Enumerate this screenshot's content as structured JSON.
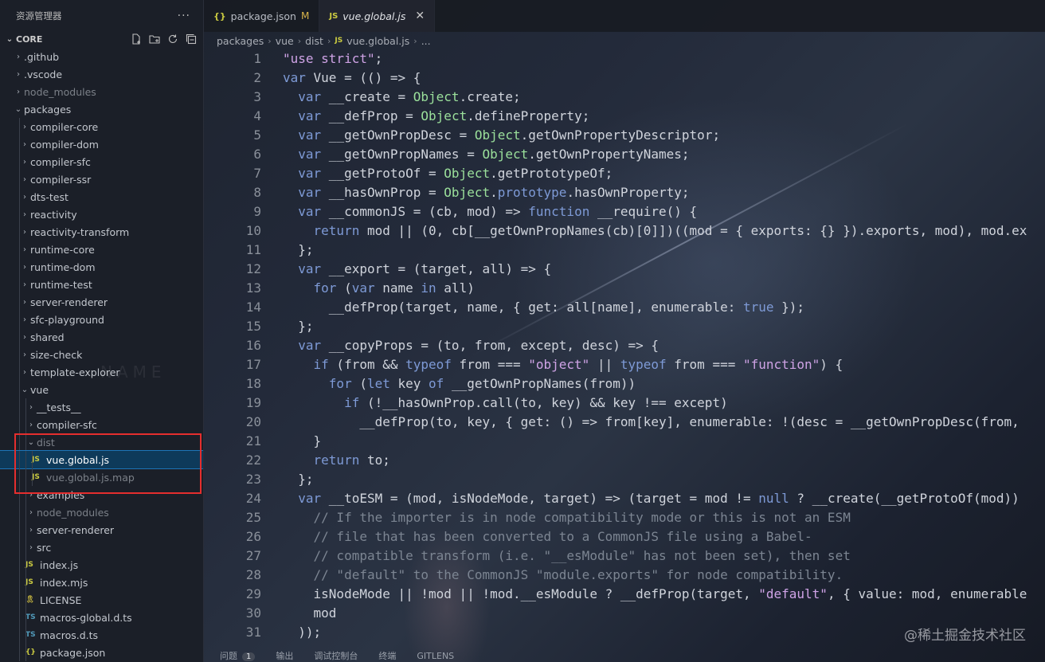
{
  "sidebar": {
    "title": "资源管理器",
    "more": "···",
    "root_label": "CORE",
    "actions": [
      "new-file-icon",
      "new-folder-icon",
      "refresh-icon",
      "collapse-all-icon"
    ],
    "background_word": "NAME",
    "items": [
      {
        "label": ".github",
        "chev": "›",
        "depth": 1,
        "type": "folder"
      },
      {
        "label": ".vscode",
        "chev": "›",
        "depth": 1,
        "type": "folder"
      },
      {
        "label": "node_modules",
        "chev": "›",
        "depth": 1,
        "type": "folder",
        "dim": true
      },
      {
        "label": "packages",
        "chev": "⌄",
        "depth": 1,
        "type": "folder-open"
      },
      {
        "label": "compiler-core",
        "chev": "›",
        "depth": 2,
        "type": "folder"
      },
      {
        "label": "compiler-dom",
        "chev": "›",
        "depth": 2,
        "type": "folder"
      },
      {
        "label": "compiler-sfc",
        "chev": "›",
        "depth": 2,
        "type": "folder"
      },
      {
        "label": "compiler-ssr",
        "chev": "›",
        "depth": 2,
        "type": "folder"
      },
      {
        "label": "dts-test",
        "chev": "›",
        "depth": 2,
        "type": "folder"
      },
      {
        "label": "reactivity",
        "chev": "›",
        "depth": 2,
        "type": "folder"
      },
      {
        "label": "reactivity-transform",
        "chev": "›",
        "depth": 2,
        "type": "folder"
      },
      {
        "label": "runtime-core",
        "chev": "›",
        "depth": 2,
        "type": "folder"
      },
      {
        "label": "runtime-dom",
        "chev": "›",
        "depth": 2,
        "type": "folder"
      },
      {
        "label": "runtime-test",
        "chev": "›",
        "depth": 2,
        "type": "folder"
      },
      {
        "label": "server-renderer",
        "chev": "›",
        "depth": 2,
        "type": "folder"
      },
      {
        "label": "sfc-playground",
        "chev": "›",
        "depth": 2,
        "type": "folder"
      },
      {
        "label": "shared",
        "chev": "›",
        "depth": 2,
        "type": "folder"
      },
      {
        "label": "size-check",
        "chev": "›",
        "depth": 2,
        "type": "folder"
      },
      {
        "label": "template-explorer",
        "chev": "›",
        "depth": 2,
        "type": "folder"
      },
      {
        "label": "vue",
        "chev": "⌄",
        "depth": 2,
        "type": "folder-open"
      },
      {
        "label": "__tests__",
        "chev": "›",
        "depth": 3,
        "type": "folder"
      },
      {
        "label": "compiler-sfc",
        "chev": "›",
        "depth": 3,
        "type": "folder"
      },
      {
        "label": "dist",
        "chev": "⌄",
        "depth": 3,
        "type": "folder-open",
        "dim": true
      },
      {
        "label": "vue.global.js",
        "icon": "JS",
        "depth": 4,
        "type": "js",
        "selected": true
      },
      {
        "label": "vue.global.js.map",
        "icon": "JS",
        "depth": 4,
        "type": "js",
        "dim": true
      },
      {
        "label": "examples",
        "chev": "›",
        "depth": 3,
        "type": "folder"
      },
      {
        "label": "node_modules",
        "chev": "›",
        "depth": 3,
        "type": "folder",
        "dim": true
      },
      {
        "label": "server-renderer",
        "chev": "›",
        "depth": 3,
        "type": "folder"
      },
      {
        "label": "src",
        "chev": "›",
        "depth": 3,
        "type": "folder"
      },
      {
        "label": "index.js",
        "icon": "JS",
        "depth": 3,
        "type": "js"
      },
      {
        "label": "index.mjs",
        "icon": "JS",
        "depth": 3,
        "type": "js"
      },
      {
        "label": "LICENSE",
        "icon": "🎗",
        "depth": 3,
        "type": "license"
      },
      {
        "label": "macros-global.d.ts",
        "icon": "TS",
        "depth": 3,
        "type": "ts"
      },
      {
        "label": "macros.d.ts",
        "icon": "TS",
        "depth": 3,
        "type": "ts"
      },
      {
        "label": "package.json",
        "icon": "{}",
        "depth": 3,
        "type": "json"
      }
    ]
  },
  "tabs": [
    {
      "label": "package.json",
      "icon": "{}",
      "badge": "M",
      "active": false
    },
    {
      "label": "vue.global.js",
      "icon": "JS",
      "close": "✕",
      "active": true
    }
  ],
  "breadcrumb": [
    "packages",
    "vue",
    "dist",
    "vue.global.js",
    "..."
  ],
  "breadcrumb_sep": "›",
  "breadcrumb_js_icon": "JS",
  "code": [
    [
      [
        "str",
        "\"use strict\""
      ],
      [
        "par",
        ";"
      ]
    ],
    [
      [
        "kw",
        "var"
      ],
      [
        "par",
        " Vue = (() => {"
      ]
    ],
    [
      [
        "par",
        "  "
      ],
      [
        "kw",
        "var"
      ],
      [
        "par",
        " __create = "
      ],
      [
        "obj",
        "Object"
      ],
      [
        "par",
        ".create;"
      ]
    ],
    [
      [
        "par",
        "  "
      ],
      [
        "kw",
        "var"
      ],
      [
        "par",
        " __defProp = "
      ],
      [
        "obj",
        "Object"
      ],
      [
        "par",
        ".defineProperty;"
      ]
    ],
    [
      [
        "par",
        "  "
      ],
      [
        "kw",
        "var"
      ],
      [
        "par",
        " __getOwnPropDesc = "
      ],
      [
        "obj",
        "Object"
      ],
      [
        "par",
        ".getOwnPropertyDescriptor;"
      ]
    ],
    [
      [
        "par",
        "  "
      ],
      [
        "kw",
        "var"
      ],
      [
        "par",
        " __getOwnPropNames = "
      ],
      [
        "obj",
        "Object"
      ],
      [
        "par",
        ".getOwnPropertyNames;"
      ]
    ],
    [
      [
        "par",
        "  "
      ],
      [
        "kw",
        "var"
      ],
      [
        "par",
        " __getProtoOf = "
      ],
      [
        "obj",
        "Object"
      ],
      [
        "par",
        ".getPrototypeOf;"
      ]
    ],
    [
      [
        "par",
        "  "
      ],
      [
        "kw",
        "var"
      ],
      [
        "par",
        " __hasOwnProp = "
      ],
      [
        "obj",
        "Object"
      ],
      [
        "par",
        "."
      ],
      [
        "kw",
        "prototype"
      ],
      [
        "par",
        ".hasOwnProperty;"
      ]
    ],
    [
      [
        "par",
        "  "
      ],
      [
        "kw",
        "var"
      ],
      [
        "par",
        " __commonJS = (cb, mod) => "
      ],
      [
        "kw",
        "function"
      ],
      [
        "par",
        " __require() {"
      ]
    ],
    [
      [
        "par",
        "    "
      ],
      [
        "kw",
        "return"
      ],
      [
        "par",
        " mod || (0, cb[__getOwnPropNames(cb)[0]])((mod = { exports: {} }).exports, mod), mod.ex"
      ]
    ],
    [
      [
        "par",
        "  };"
      ]
    ],
    [
      [
        "par",
        "  "
      ],
      [
        "kw",
        "var"
      ],
      [
        "par",
        " __export = (target, all) => {"
      ]
    ],
    [
      [
        "par",
        "    "
      ],
      [
        "kw",
        "for"
      ],
      [
        "par",
        " ("
      ],
      [
        "kw",
        "var"
      ],
      [
        "par",
        " name "
      ],
      [
        "kw",
        "in"
      ],
      [
        "par",
        " all)"
      ]
    ],
    [
      [
        "par",
        "      __defProp(target, name, { get: all[name], enumerable: "
      ],
      [
        "kw",
        "true"
      ],
      [
        "par",
        " });"
      ]
    ],
    [
      [
        "par",
        "  };"
      ]
    ],
    [
      [
        "par",
        "  "
      ],
      [
        "kw",
        "var"
      ],
      [
        "par",
        " __copyProps = (to, from, except, desc) => {"
      ]
    ],
    [
      [
        "par",
        "    "
      ],
      [
        "kw",
        "if"
      ],
      [
        "par",
        " (from && "
      ],
      [
        "kw",
        "typeof"
      ],
      [
        "par",
        " from === "
      ],
      [
        "str",
        "\"object\""
      ],
      [
        "par",
        " || "
      ],
      [
        "kw",
        "typeof"
      ],
      [
        "par",
        " from === "
      ],
      [
        "str",
        "\"function\""
      ],
      [
        "par",
        ") {"
      ]
    ],
    [
      [
        "par",
        "      "
      ],
      [
        "kw",
        "for"
      ],
      [
        "par",
        " ("
      ],
      [
        "kw",
        "let"
      ],
      [
        "par",
        " key "
      ],
      [
        "kw",
        "of"
      ],
      [
        "par",
        " __getOwnPropNames(from))"
      ]
    ],
    [
      [
        "par",
        "        "
      ],
      [
        "kw",
        "if"
      ],
      [
        "par",
        " (!__hasOwnProp.call(to, key) && key !== except)"
      ]
    ],
    [
      [
        "par",
        "          __defProp(to, key, { get: () => from[key], enumerable: !(desc = __getOwnPropDesc(from, "
      ]
    ],
    [
      [
        "par",
        "    }"
      ]
    ],
    [
      [
        "par",
        "    "
      ],
      [
        "kw",
        "return"
      ],
      [
        "par",
        " to;"
      ]
    ],
    [
      [
        "par",
        "  };"
      ]
    ],
    [
      [
        "par",
        "  "
      ],
      [
        "kw",
        "var"
      ],
      [
        "par",
        " __toESM = (mod, isNodeMode, target) => (target = mod != "
      ],
      [
        "kw",
        "null"
      ],
      [
        "par",
        " ? __create(__getProtoOf(mod))"
      ]
    ],
    [
      [
        "cm",
        "    // If the importer is in node compatibility mode or this is not an ESM"
      ]
    ],
    [
      [
        "cm",
        "    // file that has been converted to a CommonJS file using a Babel-"
      ]
    ],
    [
      [
        "cm",
        "    // compatible transform (i.e. \"__esModule\" has not been set), then set"
      ]
    ],
    [
      [
        "cm",
        "    // \"default\" to the CommonJS \"module.exports\" for node compatibility."
      ]
    ],
    [
      [
        "par",
        "    isNodeMode || !mod || !mod.__esModule ? __defProp(target, "
      ],
      [
        "str",
        "\"default\""
      ],
      [
        "par",
        ", { value: mod, enumerable"
      ]
    ],
    [
      [
        "par",
        "    mod"
      ]
    ],
    [
      [
        "par",
        "  ));"
      ]
    ]
  ],
  "statusbar": [
    {
      "label": "问题",
      "count": "1"
    },
    {
      "label": "输出"
    },
    {
      "label": "调试控制台"
    },
    {
      "label": "终端"
    },
    {
      "label": "GITLENS"
    }
  ],
  "watermark": "@稀土掘金技术社区",
  "colors": {
    "keyword": "#7e9ad6",
    "string": "#cfa3e6",
    "object": "#9be09b",
    "comment": "#7c8592",
    "selection_outline": "#1d75b8",
    "highlight_box": "#e52e2e",
    "modified_badge": "#d9b44a"
  }
}
